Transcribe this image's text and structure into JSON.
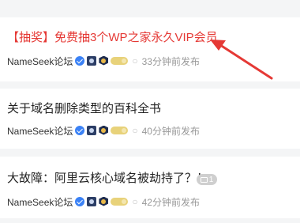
{
  "posts": [
    {
      "title": "【抽奖】免费抽3个WP之家永久VIP会员",
      "author": "NameSeek论坛",
      "time": "33分钟前发布",
      "highlight_color": "#e53935"
    },
    {
      "title": "关于域名删除类型的百科全书",
      "author": "NameSeek论坛",
      "time": "40分钟前发布"
    },
    {
      "title": "大故障：阿里云核心域名被劫持了？！",
      "author": "NameSeek论坛",
      "time": "42分钟前发布",
      "image_count": "1"
    }
  ],
  "icons": {
    "verified": "verified-icon",
    "level": "level-badge-icon",
    "medal": "medal-icon",
    "coin": "coin-badge-icon",
    "image": "image-icon"
  },
  "annotation": {
    "arrow_color": "#e53935"
  }
}
